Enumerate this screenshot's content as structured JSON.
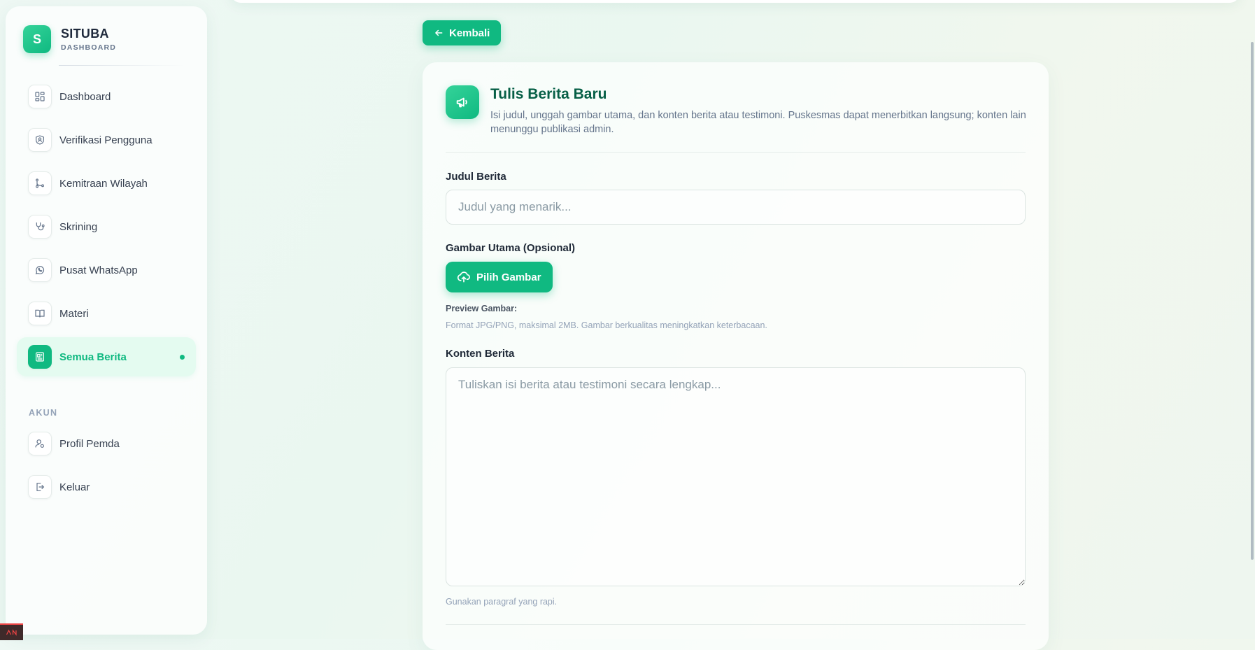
{
  "brand": {
    "logo_letter": "S",
    "title": "SITUBA",
    "subtitle": "DASHBOARD"
  },
  "sidebar": {
    "items": [
      {
        "label": "Dashboard",
        "icon": "grid-icon"
      },
      {
        "label": "Verifikasi Pengguna",
        "icon": "shield-user-icon"
      },
      {
        "label": "Kemitraan Wilayah",
        "icon": "git-branch-icon"
      },
      {
        "label": "Skrining",
        "icon": "stethoscope-icon"
      },
      {
        "label": "Pusat WhatsApp",
        "icon": "whatsapp-icon"
      },
      {
        "label": "Materi",
        "icon": "book-open-icon"
      },
      {
        "label": "Semua Berita",
        "icon": "newspaper-icon",
        "active": true
      }
    ],
    "account_section_label": "AKUN",
    "account_items": [
      {
        "label": "Profil Pemda",
        "icon": "user-settings-icon"
      },
      {
        "label": "Keluar",
        "icon": "logout-icon"
      }
    ]
  },
  "back_button": {
    "label": "Kembali",
    "icon": "arrow-left-icon"
  },
  "form": {
    "title": "Tulis Berita Baru",
    "description": "Isi judul, unggah gambar utama, dan konten berita atau testimoni. Puskesmas dapat menerbitkan langsung; konten lain menunggu publikasi admin.",
    "title_field": {
      "label": "Judul Berita",
      "placeholder": "Judul yang menarik...",
      "value": ""
    },
    "image_field": {
      "label": "Gambar Utama (Opsional)",
      "button_label": "Pilih Gambar",
      "preview_label": "Preview Gambar:",
      "hint": "Format JPG/PNG, maksimal 2MB. Gambar berkualitas meningkatkan keterbacaan."
    },
    "content_field": {
      "label": "Konten Berita",
      "placeholder": "Tuliskan isi berita atau testimoni secara lengkap...",
      "value": "",
      "hint": "Gunakan paragraf yang rapi."
    }
  },
  "colors": {
    "accent": "#10b981",
    "accent_light": "#34d399",
    "title_dark_green": "#065f46"
  }
}
